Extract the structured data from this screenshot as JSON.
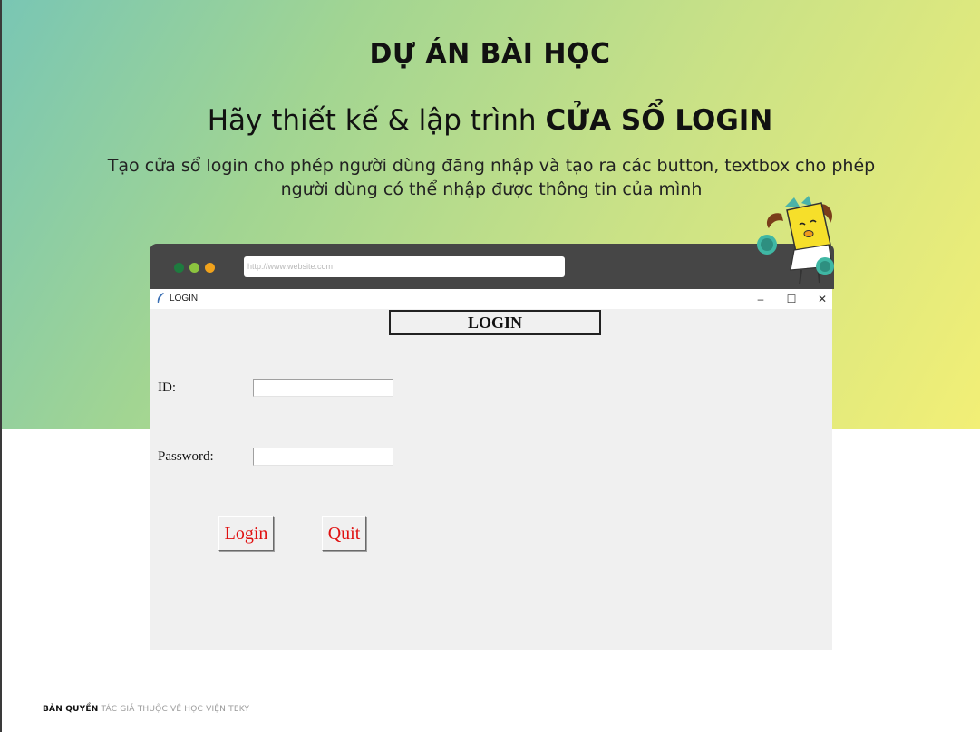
{
  "slide": {
    "title": "DỰ ÁN BÀI HỌC",
    "subtitle_prefix": "Hãy thiết kế & lập trình ",
    "subtitle_bold": "CỬA SỔ LOGIN",
    "description_line1": "Tạo cửa sổ login cho phép người dùng đăng nhập và tạo ra các button, textbox cho phép",
    "description_line2": "người dùng có thể nhập được thông tin của mình"
  },
  "browser": {
    "url": "http://www.website.com",
    "dot_colors": [
      "#1e7b3f",
      "#8cc43f",
      "#f1a31c"
    ]
  },
  "window": {
    "title": "LOGIN",
    "minimize_glyph": "–",
    "maximize_glyph": "☐",
    "close_glyph": "✕"
  },
  "form": {
    "heading": "LOGIN",
    "id_label": "ID:",
    "id_value": "",
    "password_label": "Password:",
    "password_value": "",
    "login_button": "Login",
    "quit_button": "Quit",
    "button_text_color": "#e01010"
  },
  "footer": {
    "bold": "BẢN QUYỀN",
    "rest": " TÁC GIẢ THUỘC VỀ HỌC VIỆN TEKY"
  },
  "icons": {
    "window_icon": "feather-icon",
    "mascot": "cheerleader-mascot"
  }
}
